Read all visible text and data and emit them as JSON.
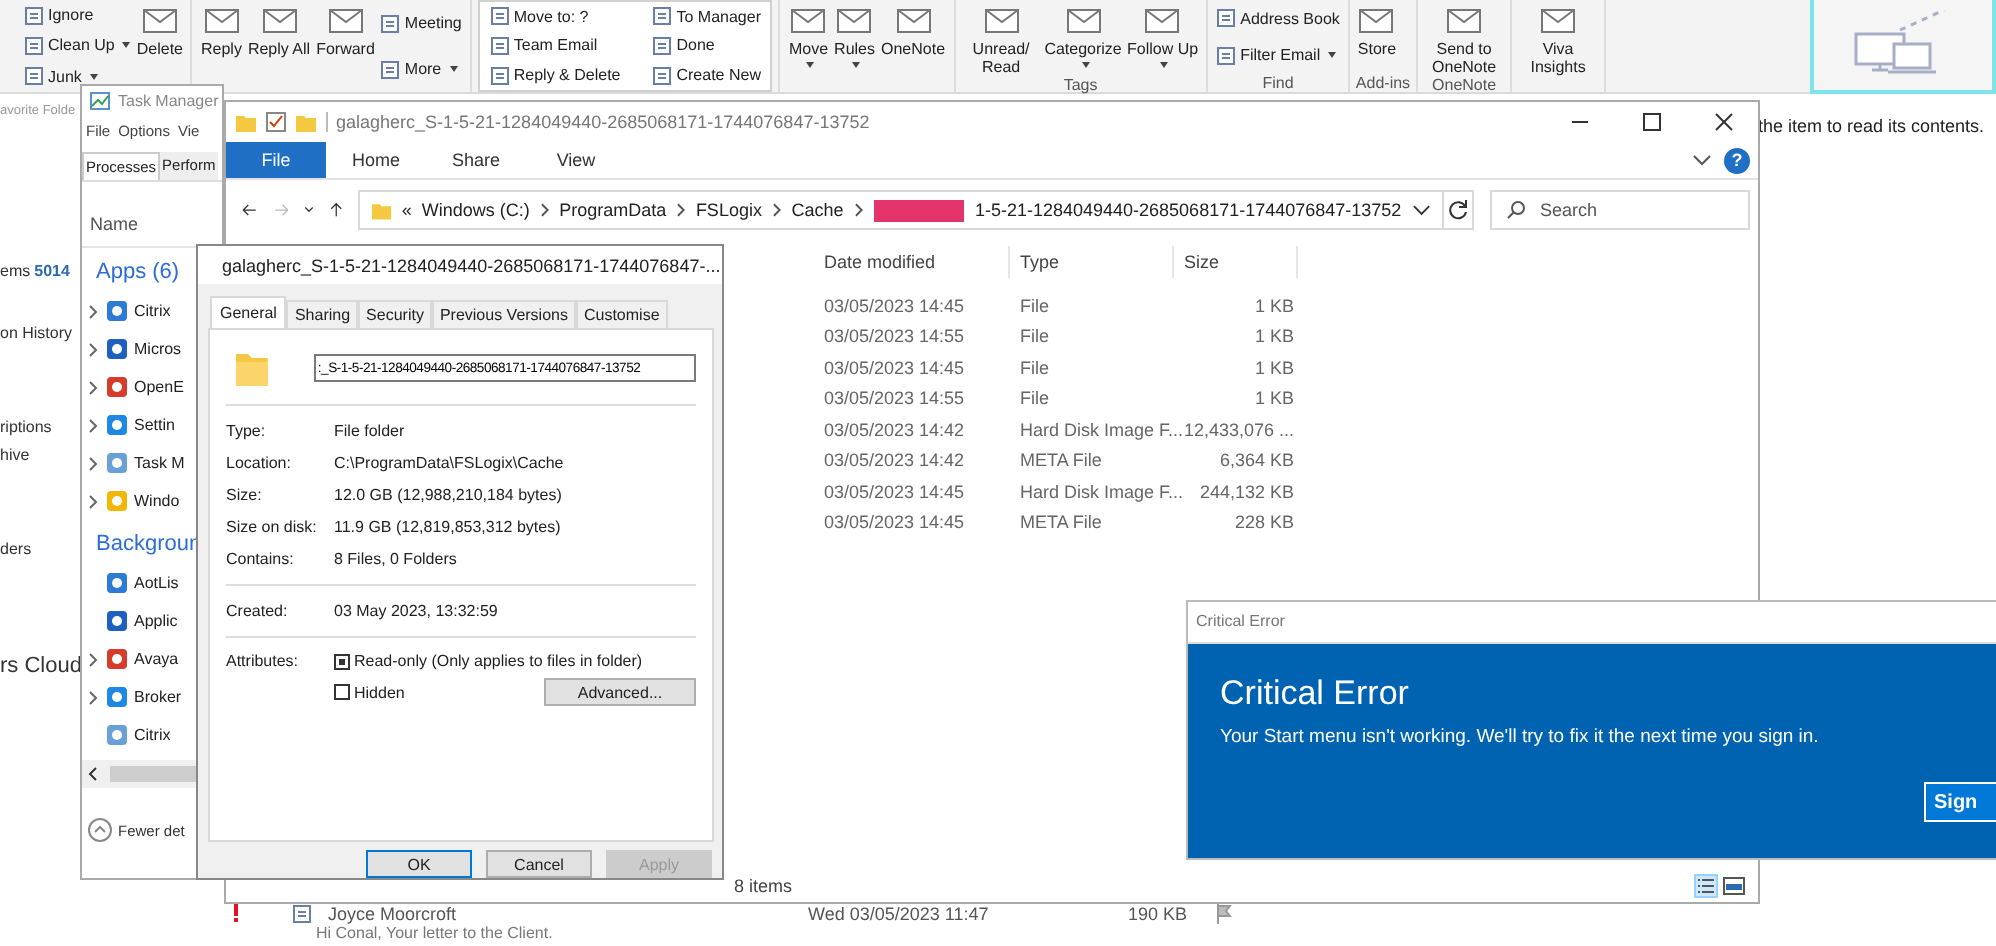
{
  "outlook": {
    "ribbon": {
      "groups": [
        {
          "columns": [
            [
              {
                "label": "Ignore"
              },
              {
                "label": "Clean Up",
                "dropdown": true
              },
              {
                "label": "Junk",
                "dropdown": true
              }
            ],
            [
              {
                "label": "Delete"
              }
            ]
          ]
        },
        {
          "columns": [
            [
              {
                "label": "Reply"
              }
            ],
            [
              {
                "label": "Reply All"
              }
            ],
            [
              {
                "label": "Forward"
              }
            ],
            [
              {
                "label": "Meeting"
              },
              {
                "label": "More",
                "dropdown": true
              }
            ]
          ]
        },
        {
          "kind": "gallery",
          "columns": [
            [
              {
                "label": "Move to: ?"
              },
              {
                "label": "Team Email"
              },
              {
                "label": "Reply & Delete"
              }
            ],
            [
              {
                "label": "To Manager"
              },
              {
                "label": "Done"
              },
              {
                "label": "Create New"
              }
            ]
          ]
        },
        {
          "columns": [
            [
              {
                "label": "Move",
                "dropdown": true
              }
            ],
            [
              {
                "label": "Rules",
                "dropdown": true
              }
            ],
            [
              {
                "label": "OneNote"
              }
            ]
          ]
        },
        {
          "label": "Tags",
          "columns": [
            [
              {
                "label": "Unread/ Read"
              }
            ],
            [
              {
                "label": "Categorize",
                "dropdown": true
              }
            ],
            [
              {
                "label": "Follow Up",
                "dropdown": true
              }
            ]
          ]
        },
        {
          "label": "Find",
          "columns": [
            [
              {
                "label": "Address Book"
              },
              {
                "label": "Filter Email",
                "dropdown": true
              }
            ]
          ]
        },
        {
          "label": "Add-ins",
          "columns": [
            [
              {
                "label": "Store"
              }
            ]
          ]
        },
        {
          "label": "OneNote",
          "columns": [
            [
              {
                "label": "Send to OneNote"
              }
            ]
          ]
        },
        {
          "columns": [
            [
              {
                "label": "Viva Insights"
              }
            ]
          ]
        }
      ]
    },
    "folder_pane": [
      {
        "text": "avorite Folde"
      },
      {
        "text": "ems",
        "count": "5014"
      },
      {
        "text": "on History"
      },
      {
        "text": "riptions"
      },
      {
        "text": "hive"
      },
      {
        "text": "ders"
      },
      {
        "text": "rs Cloud"
      }
    ],
    "reading_hint": "the item to read its contents.",
    "messages": [
      {
        "important": true,
        "from": "Joyce Moorcroft",
        "received": "Wed 03/05/2023 11:47",
        "size": "190 KB",
        "preview": "Hi Conal,  Your letter to the Client.",
        "flagged": false
      }
    ]
  },
  "task_manager": {
    "title": "Task Manager",
    "menu": [
      "File",
      "Options",
      "Vie"
    ],
    "tabs": [
      {
        "label": "Processes",
        "selected": true
      },
      {
        "label": "Perform",
        "selected": false
      }
    ],
    "column": "Name",
    "groups": [
      {
        "title": "Apps (6)",
        "items": [
          {
            "name": "Citrix",
            "expandable": true
          },
          {
            "name": "Micros",
            "expandable": true
          },
          {
            "name": "OpenE",
            "expandable": true
          },
          {
            "name": "Settin",
            "expandable": true
          },
          {
            "name": "Task M",
            "expandable": true
          },
          {
            "name": "Windo",
            "expandable": true
          }
        ]
      },
      {
        "title": "Backgroun",
        "items": [
          {
            "name": "AotLis",
            "expandable": false
          },
          {
            "name": "Applic",
            "expandable": false
          },
          {
            "name": "Avaya",
            "expandable": true
          },
          {
            "name": "Broker",
            "expandable": true
          },
          {
            "name": "Citrix",
            "expandable": false
          }
        ]
      }
    ],
    "footer": "Fewer det"
  },
  "explorer": {
    "title": "galagherc_S-1-5-21-1284049440-2685068171-1744076847-13752",
    "tabs": [
      {
        "label": "File",
        "selected": true
      },
      {
        "label": "Home",
        "selected": false
      },
      {
        "label": "Share",
        "selected": false
      },
      {
        "label": "View",
        "selected": false
      }
    ],
    "help": "?",
    "address": {
      "overflow": "«",
      "crumbs": [
        "Windows (C:)",
        "ProgramData",
        "FSLogix",
        "Cache"
      ],
      "redacted": true,
      "tail": "1-5-21-1284049440-2685068171-1744076847-13752"
    },
    "search_placeholder": "Search",
    "columns": [
      "Date modified",
      "Type",
      "Size"
    ],
    "rows": [
      {
        "date": "03/05/2023 14:45",
        "type": "File",
        "size": "1 KB"
      },
      {
        "date": "03/05/2023 14:55",
        "type": "File",
        "size": "1 KB"
      },
      {
        "date": "03/05/2023 14:45",
        "type": "File",
        "size": "1 KB"
      },
      {
        "date": "03/05/2023 14:55",
        "type": "File",
        "size": "1 KB"
      },
      {
        "date": "03/05/2023 14:42",
        "type": "Hard Disk Image F...",
        "size": "12,433,076 ..."
      },
      {
        "date": "03/05/2023 14:42",
        "type": "META File",
        "size": "6,364 KB"
      },
      {
        "date": "03/05/2023 14:45",
        "type": "Hard Disk Image F...",
        "size": "244,132 KB"
      },
      {
        "date": "03/05/2023 14:45",
        "type": "META File",
        "size": "228 KB"
      }
    ],
    "status": "8 items"
  },
  "properties": {
    "title": "galagherc_S-1-5-21-1284049440-2685068171-1744076847-...",
    "tabs": [
      {
        "label": "General",
        "selected": true
      },
      {
        "label": "Sharing",
        "selected": false
      },
      {
        "label": "Security",
        "selected": false
      },
      {
        "label": "Previous Versions",
        "selected": false
      },
      {
        "label": "Customise",
        "selected": false
      }
    ],
    "name_value": ":_S-1-5-21-1284049440-2685068171-1744076847-13752",
    "sections": [
      [
        {
          "label": "Type:",
          "value": "File folder"
        },
        {
          "label": "Location:",
          "value": "C:\\ProgramData\\FSLogix\\Cache"
        },
        {
          "label": "Size:",
          "value": "12.0 GB (12,988,210,184 bytes)"
        },
        {
          "label": "Size on disk:",
          "value": "11.9 GB (12,819,853,312 bytes)"
        },
        {
          "label": "Contains:",
          "value": "8 Files, 0 Folders"
        }
      ],
      [
        {
          "label": "Created:",
          "value": "03 May 2023, 13:32:59"
        }
      ]
    ],
    "attributes": {
      "label": "Attributes:",
      "options": [
        {
          "label": "Read-only (Only applies to files in folder)",
          "checked": true
        },
        {
          "label": "Hidden",
          "checked": false
        }
      ],
      "button": "Advanced..."
    },
    "buttons": [
      {
        "label": "OK",
        "default": true,
        "disabled": false
      },
      {
        "label": "Cancel",
        "default": false,
        "disabled": false
      },
      {
        "label": "Apply",
        "default": false,
        "disabled": true
      }
    ]
  },
  "critical_error": {
    "window_title": "Critical Error",
    "heading": "Critical Error",
    "message": "Your Start menu isn't working. We'll try to fix it the next time you sign in.",
    "button": "Sign"
  }
}
